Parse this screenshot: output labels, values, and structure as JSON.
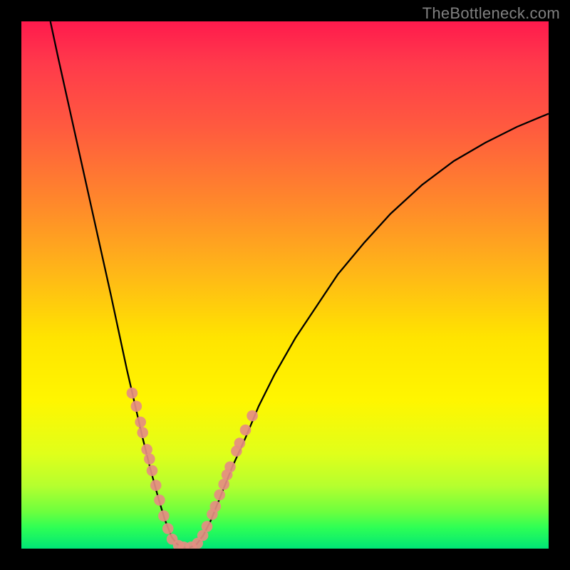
{
  "watermark": "TheBottleneck.com",
  "chart_data": {
    "type": "line",
    "title": "",
    "xlabel": "",
    "ylabel": "",
    "xlim": [
      0,
      100
    ],
    "ylim": [
      0,
      100
    ],
    "grid": false,
    "curve": [
      {
        "x": 5.5,
        "y": 100
      },
      {
        "x": 7,
        "y": 93
      },
      {
        "x": 9,
        "y": 84
      },
      {
        "x": 11,
        "y": 75
      },
      {
        "x": 13,
        "y": 66
      },
      {
        "x": 15,
        "y": 57
      },
      {
        "x": 17,
        "y": 48
      },
      {
        "x": 18.5,
        "y": 41
      },
      {
        "x": 20,
        "y": 34
      },
      {
        "x": 21.5,
        "y": 27.5
      },
      {
        "x": 23,
        "y": 21
      },
      {
        "x": 24.5,
        "y": 15
      },
      {
        "x": 26,
        "y": 9.5
      },
      {
        "x": 27.2,
        "y": 5.5
      },
      {
        "x": 28.5,
        "y": 2.2
      },
      {
        "x": 29.6,
        "y": 0.8
      },
      {
        "x": 30.8,
        "y": 0.2
      },
      {
        "x": 32,
        "y": 0.2
      },
      {
        "x": 33.2,
        "y": 0.8
      },
      {
        "x": 34.5,
        "y": 2.5
      },
      {
        "x": 36,
        "y": 5.5
      },
      {
        "x": 38,
        "y": 10.5
      },
      {
        "x": 40,
        "y": 15.5
      },
      {
        "x": 42.5,
        "y": 21
      },
      {
        "x": 45,
        "y": 27
      },
      {
        "x": 48,
        "y": 33
      },
      {
        "x": 52,
        "y": 40
      },
      {
        "x": 56,
        "y": 46
      },
      {
        "x": 60,
        "y": 52
      },
      {
        "x": 65,
        "y": 58
      },
      {
        "x": 70,
        "y": 63.5
      },
      {
        "x": 76,
        "y": 69
      },
      {
        "x": 82,
        "y": 73.5
      },
      {
        "x": 88,
        "y": 77
      },
      {
        "x": 94,
        "y": 80
      },
      {
        "x": 100,
        "y": 82.5
      }
    ],
    "points": [
      {
        "x": 21.0,
        "y": 29.5
      },
      {
        "x": 21.8,
        "y": 27.0
      },
      {
        "x": 22.6,
        "y": 24.0
      },
      {
        "x": 23.0,
        "y": 22.0
      },
      {
        "x": 23.8,
        "y": 18.8
      },
      {
        "x": 24.3,
        "y": 17.0
      },
      {
        "x": 24.8,
        "y": 14.8
      },
      {
        "x": 25.5,
        "y": 12.0
      },
      {
        "x": 26.2,
        "y": 9.2
      },
      {
        "x": 27.0,
        "y": 6.2
      },
      {
        "x": 27.8,
        "y": 3.8
      },
      {
        "x": 28.6,
        "y": 1.8
      },
      {
        "x": 29.8,
        "y": 0.6
      },
      {
        "x": 30.8,
        "y": 0.3
      },
      {
        "x": 32.2,
        "y": 0.3
      },
      {
        "x": 33.4,
        "y": 1.0
      },
      {
        "x": 34.4,
        "y": 2.5
      },
      {
        "x": 35.2,
        "y": 4.2
      },
      {
        "x": 36.2,
        "y": 6.5
      },
      {
        "x": 36.8,
        "y": 8.0
      },
      {
        "x": 37.6,
        "y": 10.2
      },
      {
        "x": 38.4,
        "y": 12.2
      },
      {
        "x": 39.0,
        "y": 14.0
      },
      {
        "x": 39.6,
        "y": 15.5
      },
      {
        "x": 40.8,
        "y": 18.5
      },
      {
        "x": 41.4,
        "y": 20.0
      },
      {
        "x": 42.5,
        "y": 22.5
      },
      {
        "x": 43.8,
        "y": 25.2
      }
    ],
    "colors": {
      "curve": "#000000",
      "points": "#e58d82",
      "gradient_top": "#ff1a4d",
      "gradient_mid": "#ffe400",
      "gradient_bottom": "#00e676"
    }
  }
}
